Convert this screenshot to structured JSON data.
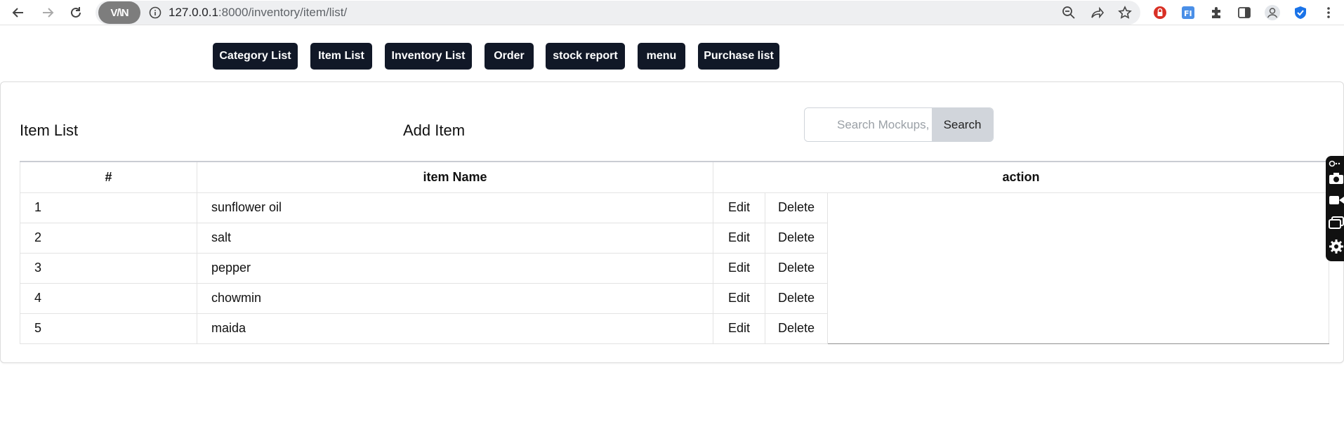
{
  "browser": {
    "vpn_badge": "V/\\N",
    "url_host": "127.0.0.1",
    "url_rest": ":8000/inventory/item/list/"
  },
  "topnav": [
    {
      "label": "Category List"
    },
    {
      "label": "Item List"
    },
    {
      "label": "Inventory List"
    },
    {
      "label": "Order"
    },
    {
      "label": "stock report"
    },
    {
      "label": "menu"
    },
    {
      "label": "Purchase list"
    }
  ],
  "page": {
    "title": "Item List",
    "add_item": "Add Item",
    "search": {
      "placeholder": "Search Mockups, Logos...",
      "button": "Search"
    }
  },
  "table": {
    "headers": [
      "#",
      "item Name",
      "action"
    ],
    "edit_label": "Edit",
    "delete_label": "Delete",
    "rows": [
      {
        "num": "1",
        "name": "sunflower oil"
      },
      {
        "num": "2",
        "name": "salt"
      },
      {
        "num": "3",
        "name": "pepper"
      },
      {
        "num": "4",
        "name": "chowmin"
      },
      {
        "num": "5",
        "name": "maida"
      }
    ]
  }
}
